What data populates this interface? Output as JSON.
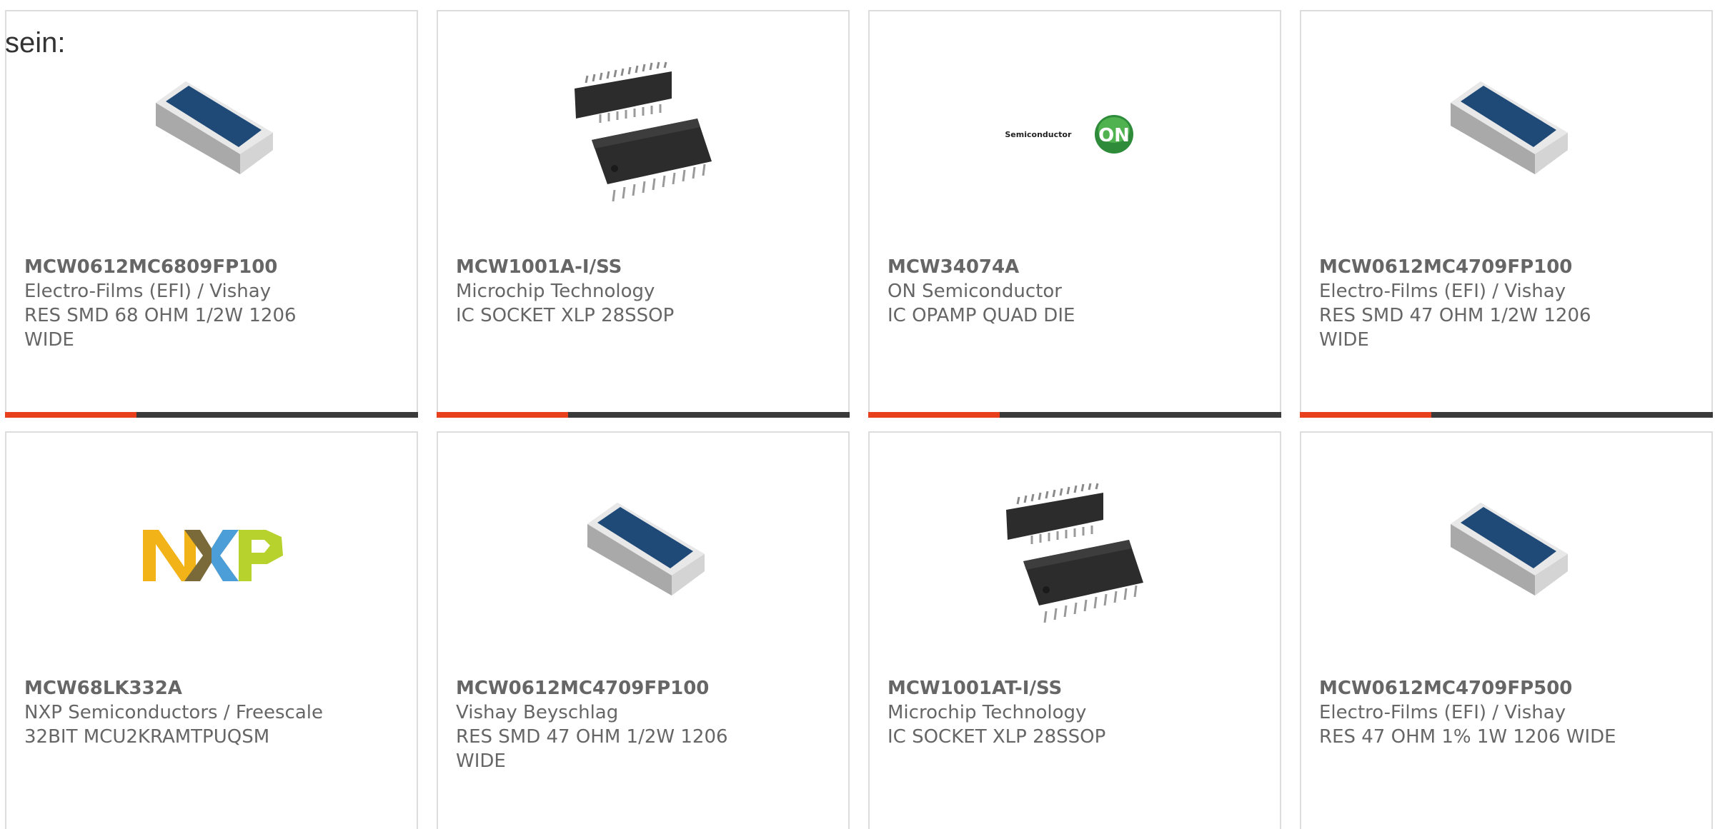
{
  "lead_text": "sein:",
  "colors": {
    "accent": "#e8401c",
    "bar": "#3a3a3a",
    "text": "#666666",
    "border": "#dddddd",
    "resistor_top": "#1f4a78",
    "chip_body": "#2c2c2c",
    "on_green": "#2e8b3a"
  },
  "products": [
    {
      "part": "MCW0612MC6809FP100",
      "manufacturer": "Electro-Films (EFI) / Vishay",
      "desc_line1": "RES SMD 68 OHM 1/2W 1206",
      "desc_line2": "WIDE",
      "image": "resistor-chip-image"
    },
    {
      "part": "MCW1001A-I/SS",
      "manufacturer": "Microchip Technology",
      "desc_line1": "IC SOCKET XLP 28SSOP",
      "desc_line2": "",
      "image": "ssop-chip-image"
    },
    {
      "part": "MCW34074A",
      "manufacturer": "ON Semiconductor",
      "desc_line1": "IC OPAMP QUAD DIE",
      "desc_line2": "",
      "image": "on-semiconductor-logo",
      "logo_text": "ON Semiconductor",
      "logo_badge": "ON"
    },
    {
      "part": "MCW0612MC4709FP100",
      "manufacturer": "Electro-Films (EFI) / Vishay",
      "desc_line1": "RES SMD 47 OHM 1/2W 1206",
      "desc_line2": "WIDE",
      "image": "resistor-chip-image"
    },
    {
      "part": "MCW68LK332A",
      "manufacturer": "NXP Semiconductors / Freescale",
      "desc_line1": "32BIT MCU2KRAMTPUQSM",
      "desc_line2": "",
      "image": "nxp-logo"
    },
    {
      "part": "MCW0612MC4709FP100",
      "manufacturer": "Vishay Beyschlag",
      "desc_line1": "RES SMD 47 OHM 1/2W 1206",
      "desc_line2": "WIDE",
      "image": "resistor-chip-image"
    },
    {
      "part": "MCW1001AT-I/SS",
      "manufacturer": "Microchip Technology",
      "desc_line1": "IC SOCKET XLP 28SSOP",
      "desc_line2": "",
      "image": "ssop-chip-image"
    },
    {
      "part": "MCW0612MC4709FP500",
      "manufacturer": "Electro-Films (EFI) / Vishay",
      "desc_line1": "RES 47 OHM 1% 1W 1206 WIDE",
      "desc_line2": "",
      "image": "resistor-chip-image"
    }
  ]
}
